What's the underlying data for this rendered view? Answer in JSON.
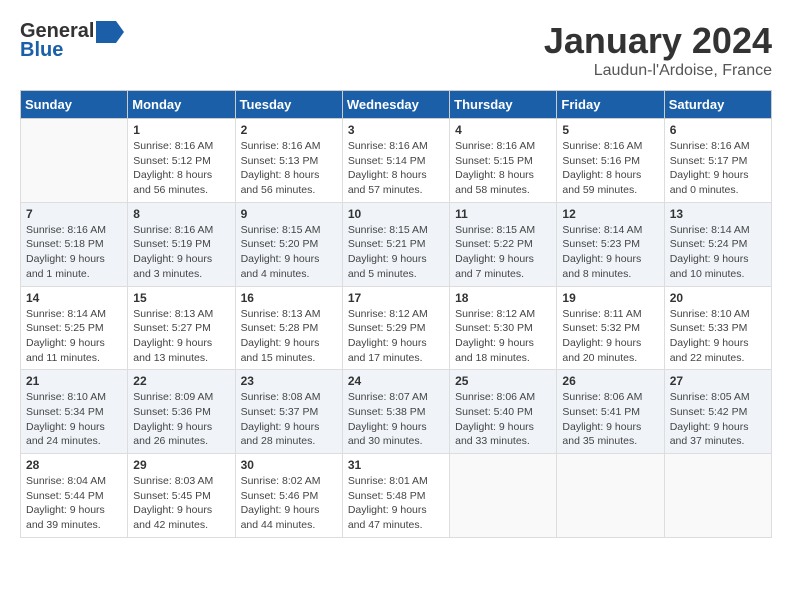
{
  "header": {
    "logo_general": "General",
    "logo_blue": "Blue",
    "month_title": "January 2024",
    "location": "Laudun-l'Ardoise, France"
  },
  "weekdays": [
    "Sunday",
    "Monday",
    "Tuesday",
    "Wednesday",
    "Thursday",
    "Friday",
    "Saturday"
  ],
  "weeks": [
    [
      {
        "day": "",
        "info": ""
      },
      {
        "day": "1",
        "info": "Sunrise: 8:16 AM\nSunset: 5:12 PM\nDaylight: 8 hours\nand 56 minutes."
      },
      {
        "day": "2",
        "info": "Sunrise: 8:16 AM\nSunset: 5:13 PM\nDaylight: 8 hours\nand 56 minutes."
      },
      {
        "day": "3",
        "info": "Sunrise: 8:16 AM\nSunset: 5:14 PM\nDaylight: 8 hours\nand 57 minutes."
      },
      {
        "day": "4",
        "info": "Sunrise: 8:16 AM\nSunset: 5:15 PM\nDaylight: 8 hours\nand 58 minutes."
      },
      {
        "day": "5",
        "info": "Sunrise: 8:16 AM\nSunset: 5:16 PM\nDaylight: 8 hours\nand 59 minutes."
      },
      {
        "day": "6",
        "info": "Sunrise: 8:16 AM\nSunset: 5:17 PM\nDaylight: 9 hours\nand 0 minutes."
      }
    ],
    [
      {
        "day": "7",
        "info": "Sunrise: 8:16 AM\nSunset: 5:18 PM\nDaylight: 9 hours\nand 1 minute."
      },
      {
        "day": "8",
        "info": "Sunrise: 8:16 AM\nSunset: 5:19 PM\nDaylight: 9 hours\nand 3 minutes."
      },
      {
        "day": "9",
        "info": "Sunrise: 8:15 AM\nSunset: 5:20 PM\nDaylight: 9 hours\nand 4 minutes."
      },
      {
        "day": "10",
        "info": "Sunrise: 8:15 AM\nSunset: 5:21 PM\nDaylight: 9 hours\nand 5 minutes."
      },
      {
        "day": "11",
        "info": "Sunrise: 8:15 AM\nSunset: 5:22 PM\nDaylight: 9 hours\nand 7 minutes."
      },
      {
        "day": "12",
        "info": "Sunrise: 8:14 AM\nSunset: 5:23 PM\nDaylight: 9 hours\nand 8 minutes."
      },
      {
        "day": "13",
        "info": "Sunrise: 8:14 AM\nSunset: 5:24 PM\nDaylight: 9 hours\nand 10 minutes."
      }
    ],
    [
      {
        "day": "14",
        "info": "Sunrise: 8:14 AM\nSunset: 5:25 PM\nDaylight: 9 hours\nand 11 minutes."
      },
      {
        "day": "15",
        "info": "Sunrise: 8:13 AM\nSunset: 5:27 PM\nDaylight: 9 hours\nand 13 minutes."
      },
      {
        "day": "16",
        "info": "Sunrise: 8:13 AM\nSunset: 5:28 PM\nDaylight: 9 hours\nand 15 minutes."
      },
      {
        "day": "17",
        "info": "Sunrise: 8:12 AM\nSunset: 5:29 PM\nDaylight: 9 hours\nand 17 minutes."
      },
      {
        "day": "18",
        "info": "Sunrise: 8:12 AM\nSunset: 5:30 PM\nDaylight: 9 hours\nand 18 minutes."
      },
      {
        "day": "19",
        "info": "Sunrise: 8:11 AM\nSunset: 5:32 PM\nDaylight: 9 hours\nand 20 minutes."
      },
      {
        "day": "20",
        "info": "Sunrise: 8:10 AM\nSunset: 5:33 PM\nDaylight: 9 hours\nand 22 minutes."
      }
    ],
    [
      {
        "day": "21",
        "info": "Sunrise: 8:10 AM\nSunset: 5:34 PM\nDaylight: 9 hours\nand 24 minutes."
      },
      {
        "day": "22",
        "info": "Sunrise: 8:09 AM\nSunset: 5:36 PM\nDaylight: 9 hours\nand 26 minutes."
      },
      {
        "day": "23",
        "info": "Sunrise: 8:08 AM\nSunset: 5:37 PM\nDaylight: 9 hours\nand 28 minutes."
      },
      {
        "day": "24",
        "info": "Sunrise: 8:07 AM\nSunset: 5:38 PM\nDaylight: 9 hours\nand 30 minutes."
      },
      {
        "day": "25",
        "info": "Sunrise: 8:06 AM\nSunset: 5:40 PM\nDaylight: 9 hours\nand 33 minutes."
      },
      {
        "day": "26",
        "info": "Sunrise: 8:06 AM\nSunset: 5:41 PM\nDaylight: 9 hours\nand 35 minutes."
      },
      {
        "day": "27",
        "info": "Sunrise: 8:05 AM\nSunset: 5:42 PM\nDaylight: 9 hours\nand 37 minutes."
      }
    ],
    [
      {
        "day": "28",
        "info": "Sunrise: 8:04 AM\nSunset: 5:44 PM\nDaylight: 9 hours\nand 39 minutes."
      },
      {
        "day": "29",
        "info": "Sunrise: 8:03 AM\nSunset: 5:45 PM\nDaylight: 9 hours\nand 42 minutes."
      },
      {
        "day": "30",
        "info": "Sunrise: 8:02 AM\nSunset: 5:46 PM\nDaylight: 9 hours\nand 44 minutes."
      },
      {
        "day": "31",
        "info": "Sunrise: 8:01 AM\nSunset: 5:48 PM\nDaylight: 9 hours\nand 47 minutes."
      },
      {
        "day": "",
        "info": ""
      },
      {
        "day": "",
        "info": ""
      },
      {
        "day": "",
        "info": ""
      }
    ]
  ]
}
